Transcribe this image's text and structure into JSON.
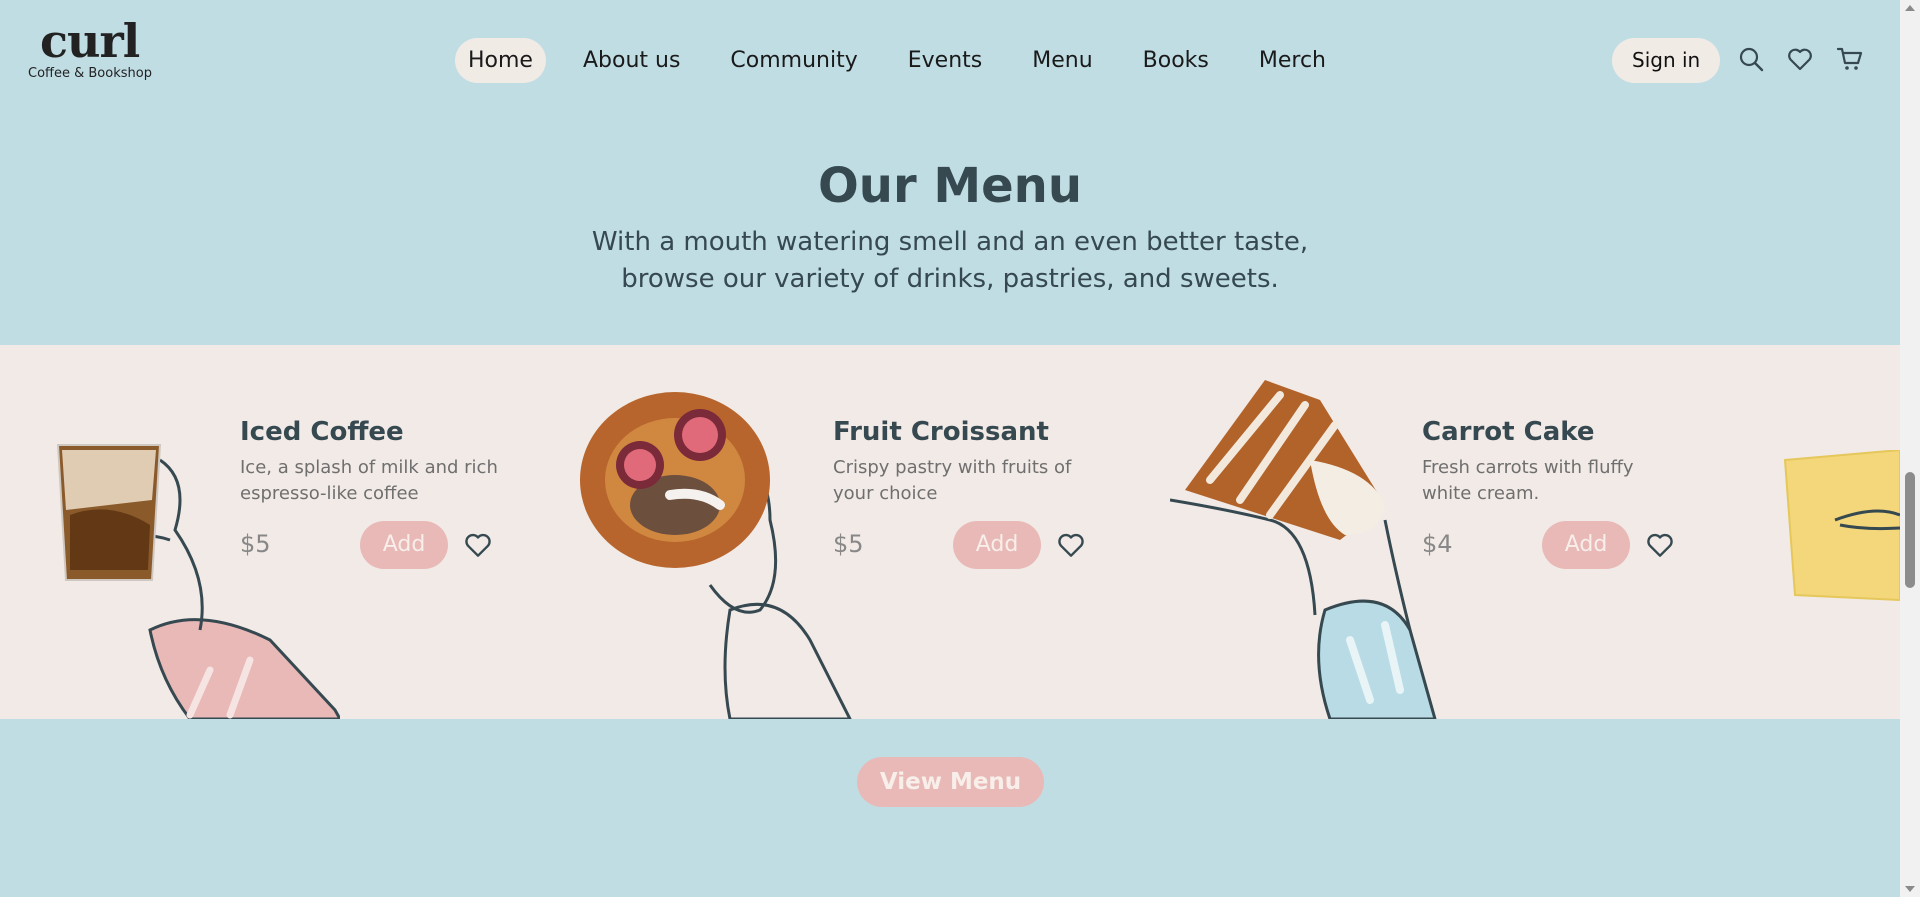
{
  "brand": {
    "name": "curl",
    "tagline": "Coffee & Bookshop"
  },
  "nav": {
    "items": [
      {
        "label": "Home",
        "active": true
      },
      {
        "label": "About us"
      },
      {
        "label": "Community"
      },
      {
        "label": "Events"
      },
      {
        "label": "Menu"
      },
      {
        "label": "Books"
      },
      {
        "label": "Merch"
      }
    ]
  },
  "header": {
    "sign_in_label": "Sign in",
    "icons": [
      "search-icon",
      "heart-icon",
      "cart-icon"
    ]
  },
  "menu_section": {
    "title": "Our Menu",
    "subtitle_line1": "With a mouth watering smell and an even better taste,",
    "subtitle_line2": "browse our variety of drinks, pastries, and sweets."
  },
  "menu_items": [
    {
      "name": "Iced Coffee",
      "desc_line1": "Ice, a splash of milk and rich",
      "desc_line2": "espresso-like coffee",
      "price": "$5",
      "add_label": "Add",
      "sleeve_color": "#e8b9b7"
    },
    {
      "name": "Fruit Croissant",
      "desc_line1": "Crispy pastry with fruits of",
      "desc_line2": "your choice",
      "price": "$5",
      "add_label": "Add",
      "sleeve_color": "#f1eae6"
    },
    {
      "name": "Carrot Cake",
      "desc_line1": "Fresh carrots with fluffy",
      "desc_line2": "white cream.",
      "price": "$4",
      "add_label": "Add",
      "sleeve_color": "#b9dbe6"
    }
  ],
  "view_menu_label": "View Menu",
  "colors": {
    "background": "#c0dde4",
    "band": "#f1eae6",
    "accent_pink": "#e8b9b7",
    "text_dark": "#364850",
    "pill": "#f1ebe6"
  }
}
